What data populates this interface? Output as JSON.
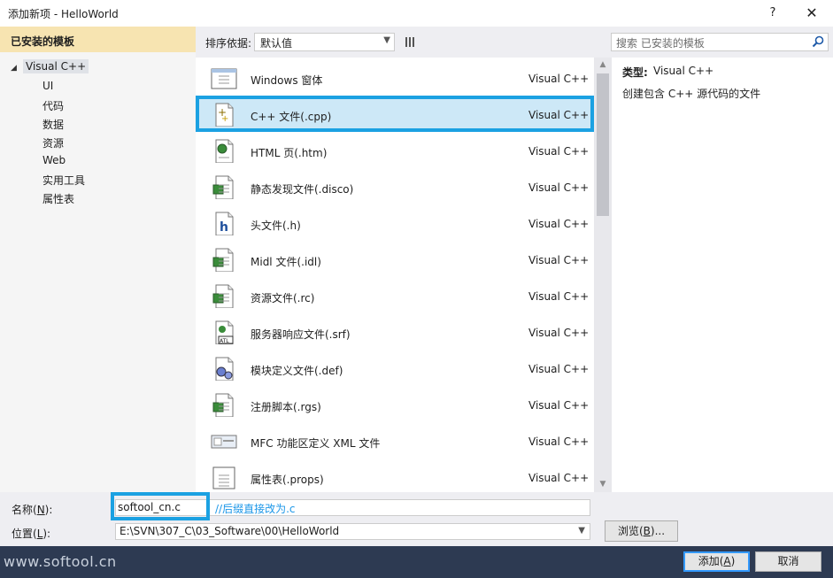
{
  "window": {
    "title": "添加新项 - HelloWorld",
    "help_label": "?",
    "close_label": "✕"
  },
  "sidebar": {
    "header": "已安装的模板",
    "root": {
      "arrow": "◢",
      "label": "Visual C++"
    },
    "children": [
      "UI",
      "代码",
      "数据",
      "资源",
      "Web",
      "实用工具",
      "属性表"
    ]
  },
  "toolbar": {
    "sort_label": "排序依据:",
    "sort_value": "默认值",
    "search_placeholder": "搜索 已安装的模板"
  },
  "templates": [
    {
      "name": "Windows 窗体",
      "lang": "Visual C++",
      "icon": "windows-form-icon"
    },
    {
      "name": "C++ 文件(.cpp)",
      "lang": "Visual C++",
      "icon": "cpp-file-icon",
      "selected": true
    },
    {
      "name": "HTML 页(.htm)",
      "lang": "Visual C++",
      "icon": "html-page-icon"
    },
    {
      "name": "静态发现文件(.disco)",
      "lang": "Visual C++",
      "icon": "disco-file-icon"
    },
    {
      "name": "头文件(.h)",
      "lang": "Visual C++",
      "icon": "header-file-icon"
    },
    {
      "name": "Midl 文件(.idl)",
      "lang": "Visual C++",
      "icon": "idl-file-icon"
    },
    {
      "name": "资源文件(.rc)",
      "lang": "Visual C++",
      "icon": "resource-file-icon"
    },
    {
      "name": "服务器响应文件(.srf)",
      "lang": "Visual C++",
      "icon": "srf-file-icon"
    },
    {
      "name": "模块定义文件(.def)",
      "lang": "Visual C++",
      "icon": "def-file-icon"
    },
    {
      "name": "注册脚本(.rgs)",
      "lang": "Visual C++",
      "icon": "rgs-file-icon"
    },
    {
      "name": "MFC 功能区定义 XML 文件",
      "lang": "Visual C++",
      "icon": "mfc-ribbon-icon"
    },
    {
      "name": "属性表(.props)",
      "lang": "Visual C++",
      "icon": "props-file-icon"
    }
  ],
  "info": {
    "type_label": "类型:",
    "type_value": "Visual C++",
    "description": "创建包含 C++ 源代码的文件"
  },
  "form": {
    "name_label_pre": "名称(",
    "name_label_key": "N",
    "name_label_post": "):",
    "name_value": "softool_cn.c",
    "name_hint": "//后缀直接改为.c",
    "location_label_pre": "位置(",
    "location_label_key": "L",
    "location_label_post": "):",
    "location_value": "E:\\SVN\\307_C\\03_Software\\00\\HelloWorld",
    "browse_pre": "浏览(",
    "browse_key": "B",
    "browse_post": ")..."
  },
  "footer": {
    "watermark": "www.softool.cn",
    "add_pre": "添加(",
    "add_key": "A",
    "add_post": ")",
    "cancel": "取消"
  },
  "colors": {
    "highlight": "#1ba1e2",
    "selected_bg": "#cde8f7",
    "header_bg": "#f7e4b1",
    "footer_bg": "#2d3a52"
  }
}
